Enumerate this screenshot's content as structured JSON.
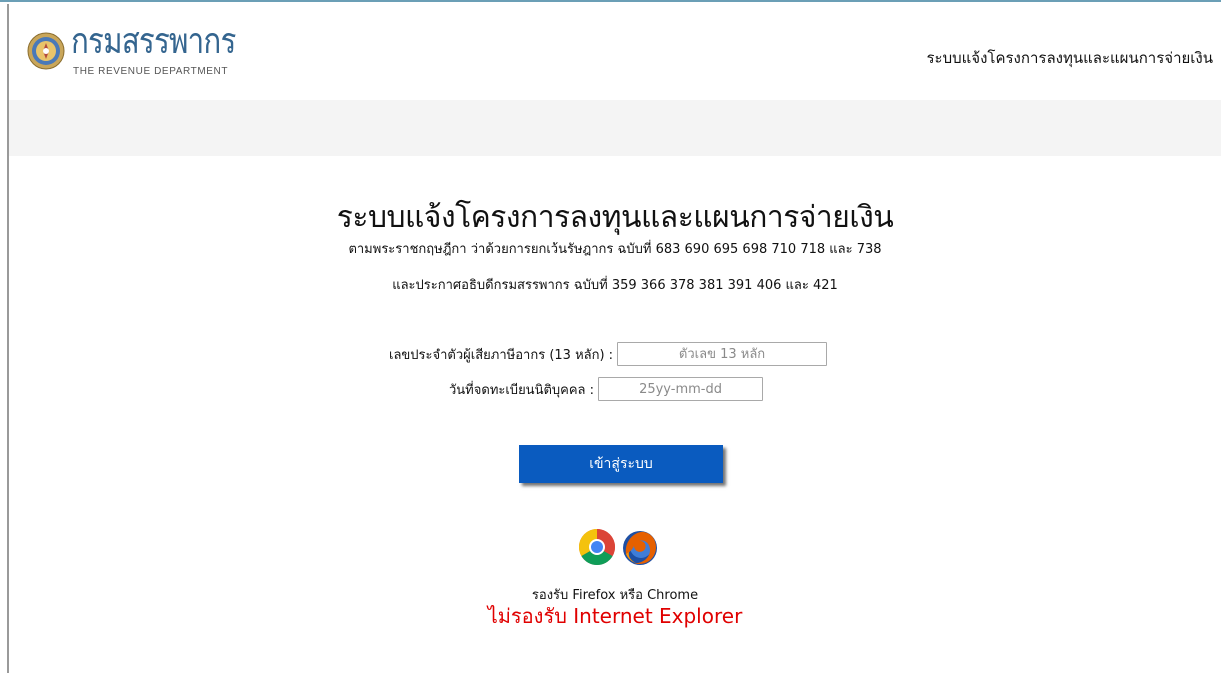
{
  "header": {
    "logo_text": "กรมสรรพากร",
    "logo_subtext": "THE REVENUE DEPARTMENT",
    "system_title": "ระบบแจ้งโครงการลงทุนและแผนการจ่ายเงิน",
    "emblem_icon": "revenue-department-emblem",
    "brand_color": "#34658f"
  },
  "main": {
    "title": "ระบบแจ้งโครงการลงทุนและแผนการจ่ายเงิน",
    "subtitle_1": "ตามพระราชกฤษฎีกา ว่าด้วยการยกเว้นรัษฎากร ฉบับที่ 683 690 695 698 710 718 และ 738",
    "subtitle_2": "และประกาศอธิบดีกรมสรรพากร ฉบับที่ 359 366 378 381 391 406 และ 421"
  },
  "form": {
    "tax_id": {
      "label": "เลขประจำตัวผู้เสียภาษีอากร (13 หลัก) :",
      "placeholder": "ตัวเลข 13 หลัก",
      "value": ""
    },
    "reg_date": {
      "label": "วันที่จดทะเบียนนิติบุคคล :",
      "placeholder": "25yy-mm-dd",
      "value": ""
    },
    "submit_label": "เข้าสู่ระบบ",
    "submit_color": "#0a5bbf"
  },
  "browser_support": {
    "icons": [
      "chrome-icon",
      "firefox-icon"
    ],
    "supported_text": "รองรับ Firefox หรือ Chrome",
    "unsupported_text": "ไม่รองรับ Internet Explorer",
    "warning_color": "#e00000"
  }
}
